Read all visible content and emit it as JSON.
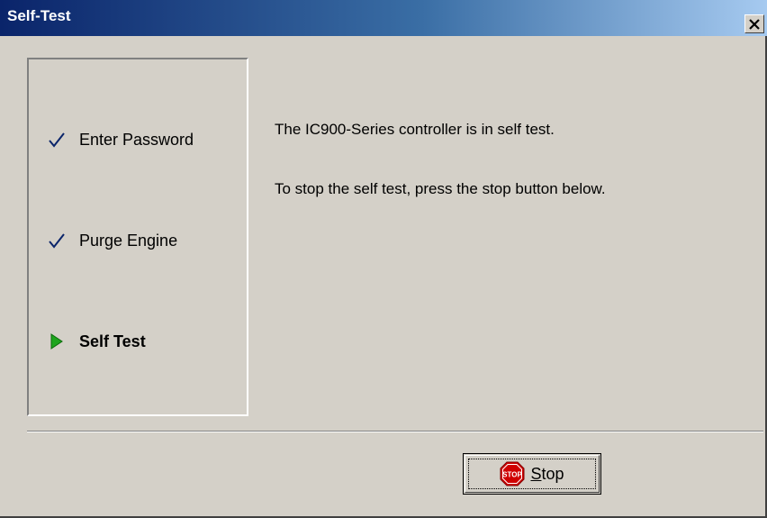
{
  "window": {
    "title": "Self-Test"
  },
  "steps": [
    {
      "label": "Enter Password",
      "status": "done",
      "icon": "checkmark-icon"
    },
    {
      "label": "Purge Engine",
      "status": "done",
      "icon": "checkmark-icon"
    },
    {
      "label": "Self Test",
      "status": "current",
      "icon": "play-arrow-icon"
    }
  ],
  "messages": {
    "line1": "The IC900-Series controller is in self test.",
    "line2": "To stop the self test, press the stop button below."
  },
  "buttons": {
    "stop_label_first": "S",
    "stop_label_rest": "top",
    "stop_icon_text": "STOP"
  },
  "colors": {
    "title_start": "#0a246a",
    "title_end": "#a6caf0",
    "check": "#0a246a",
    "arrow": "#1ea51e",
    "stop_sign": "#d00000"
  }
}
